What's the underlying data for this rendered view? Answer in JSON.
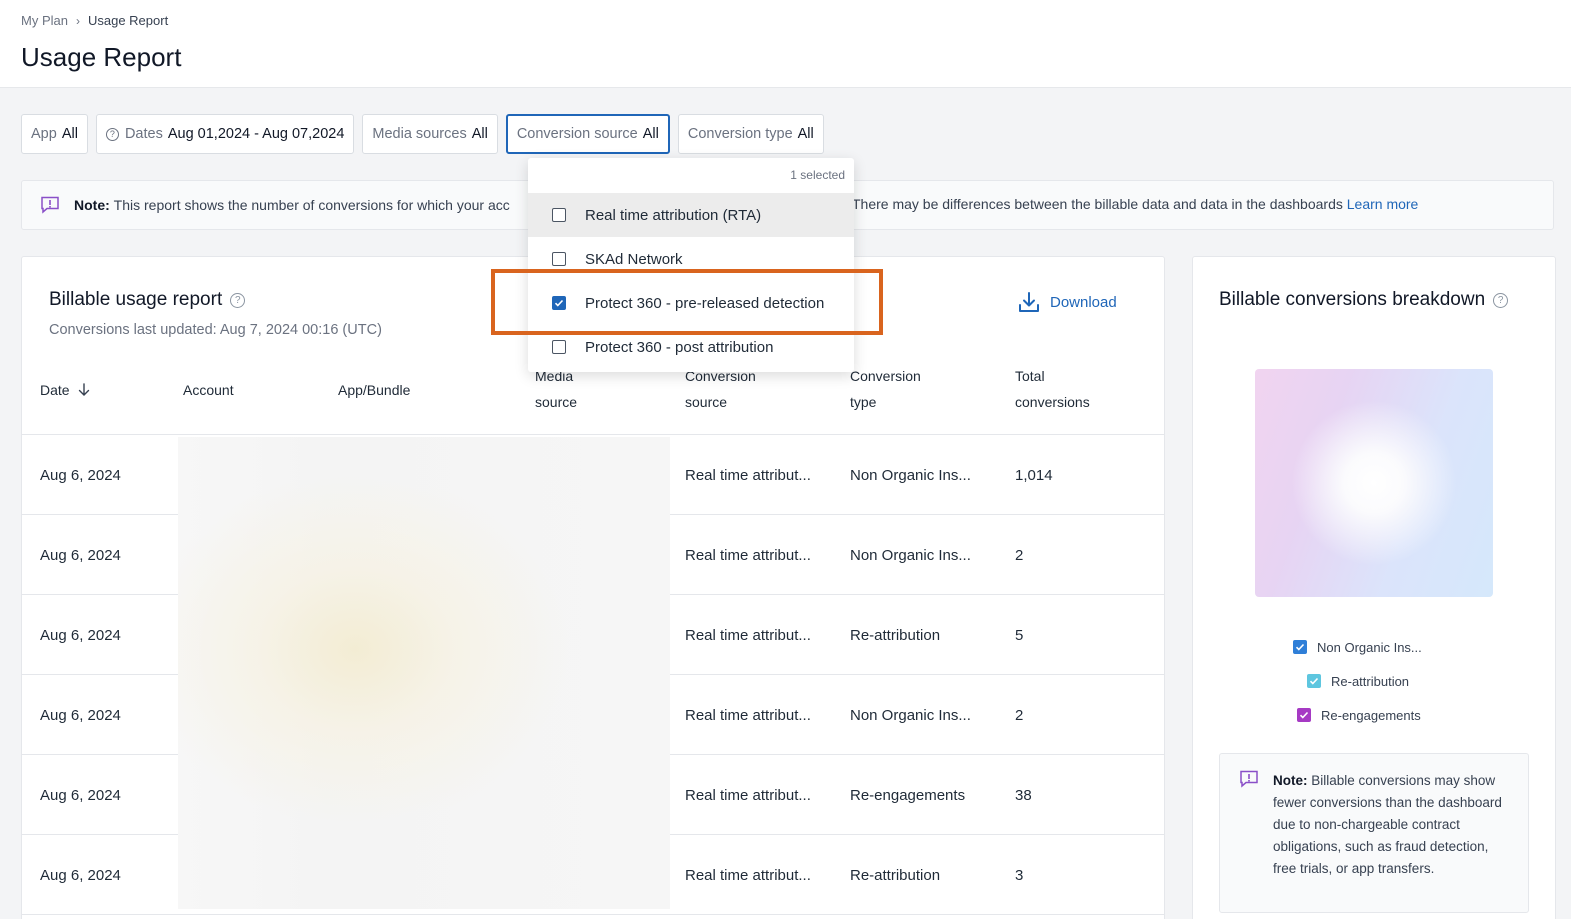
{
  "breadcrumb": {
    "parent": "My Plan",
    "current": "Usage Report"
  },
  "page_title": "Usage Report",
  "filters": {
    "app": {
      "label": "App",
      "value": "All"
    },
    "dates": {
      "label": "Dates",
      "value": "Aug 01,2024 - Aug 07,2024"
    },
    "media_sources": {
      "label": "Media sources",
      "value": "All"
    },
    "conversion_source": {
      "label": "Conversion source",
      "value": "All"
    },
    "conversion_type": {
      "label": "Conversion type",
      "value": "All"
    }
  },
  "note": {
    "prefix": "Note:",
    "text_left": "This report shows the number of conversions for which your acc",
    "text_right": "There may be differences between the billable data and data in the dashboards",
    "link": "Learn more"
  },
  "dropdown": {
    "count": "1 selected",
    "items": [
      {
        "label": "Real time attribution (RTA)",
        "checked": false
      },
      {
        "label": "SKAd Network",
        "checked": false
      },
      {
        "label": "Protect 360 - pre-released detection",
        "checked": true
      },
      {
        "label": "Protect 360 - post attribution",
        "checked": false
      }
    ]
  },
  "report": {
    "title": "Billable usage report",
    "subtitle": "Conversions last updated: Aug 7, 2024 00:16 (UTC)",
    "download": "Download",
    "columns": {
      "date": "Date",
      "account": "Account",
      "app": "App/Bundle",
      "media_1": "Media",
      "media_2": "source",
      "csource_1": "Conversion",
      "csource_2": "source",
      "ctype_1": "Conversion",
      "ctype_2": "type",
      "total_1": "Total",
      "total_2": "conversions"
    },
    "rows": [
      {
        "date": "Aug 6, 2024",
        "source": "Real time attribut...",
        "type": "Non Organic Ins...",
        "total": "1,014"
      },
      {
        "date": "Aug 6, 2024",
        "source": "Real time attribut...",
        "type": "Non Organic Ins...",
        "total": "2"
      },
      {
        "date": "Aug 6, 2024",
        "source": "Real time attribut...",
        "type": "Re-attribution",
        "total": "5"
      },
      {
        "date": "Aug 6, 2024",
        "source": "Real time attribut...",
        "type": "Non Organic Ins...",
        "total": "2"
      },
      {
        "date": "Aug 6, 2024",
        "source": "Real time attribut...",
        "type": "Re-engagements",
        "total": "38"
      },
      {
        "date": "Aug 6, 2024",
        "source": "Real time attribut...",
        "type": "Re-attribution",
        "total": "3"
      }
    ]
  },
  "breakdown": {
    "title": "Billable conversions breakdown",
    "legend": [
      {
        "label": "Non Organic Ins...",
        "color": "#2f7fd8"
      },
      {
        "label": "Re-attribution",
        "color": "#5ec6df"
      },
      {
        "label": "Re-engagements",
        "color": "#a63ac4"
      }
    ],
    "note_prefix": "Note:",
    "note_text": "Billable conversions may show fewer conversions than the dashboard due to non-chargeable contract obligations, such as fraud detection, free trials, or app transfers."
  },
  "colors": {
    "accent": "#1f66b8",
    "highlight": "#d9641e"
  }
}
